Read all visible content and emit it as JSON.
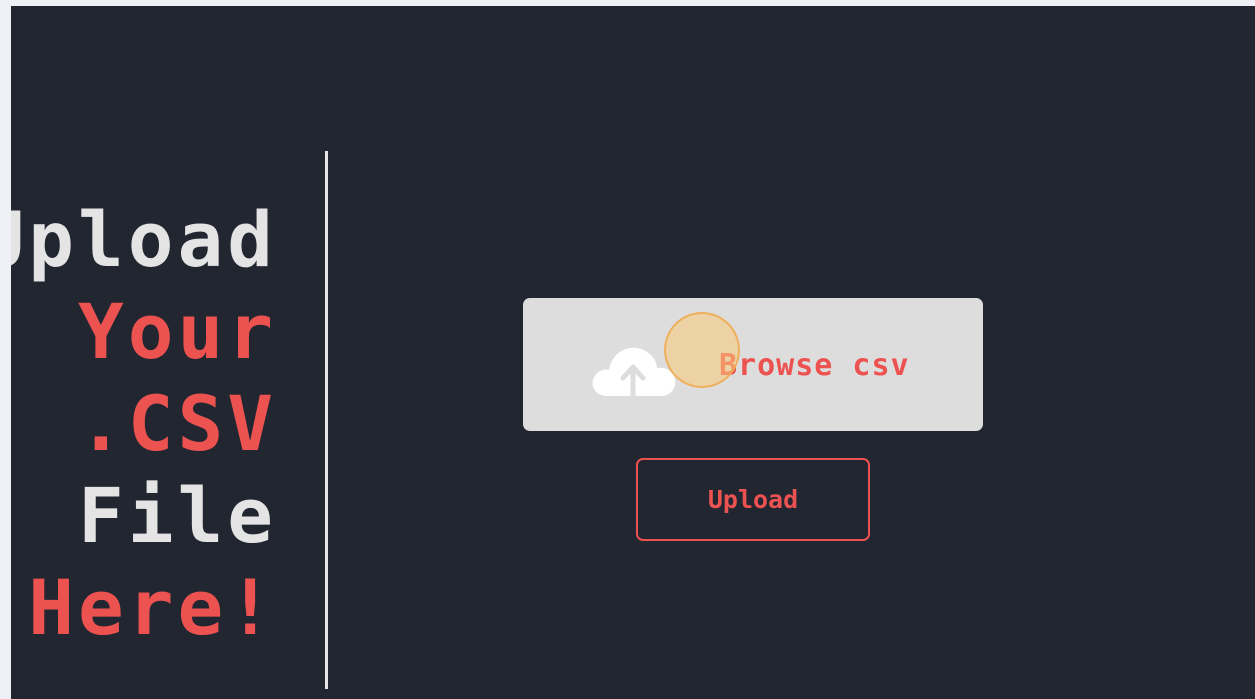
{
  "heading": {
    "line1": "Upload",
    "line2": "Your",
    "line3": ".CSV",
    "line4": "File",
    "line5": "Here!"
  },
  "browse": {
    "label": "Browse csv",
    "icon": "cloud-upload-icon"
  },
  "upload_button": {
    "label": "Upload"
  },
  "colors": {
    "background": "#212631",
    "accent": "#ec5250",
    "text_light": "#e4e4e4",
    "browse_box": "#dddddd"
  }
}
